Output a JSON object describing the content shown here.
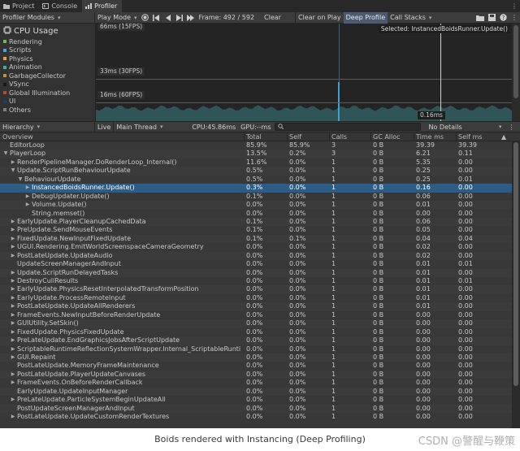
{
  "tabs": [
    {
      "label": "Project",
      "icon": "folder-icon"
    },
    {
      "label": "Console",
      "icon": "console-icon"
    },
    {
      "label": "Profiler",
      "icon": "profiler-icon"
    }
  ],
  "toolbar": {
    "modules_label": "Profiler Modules",
    "play_mode_label": "Play Mode",
    "frame_label": "Frame: 492 / 592",
    "clear_label": "Clear",
    "clear_on_play_label": "Clear on Play",
    "deep_profile_label": "Deep Profile",
    "call_stacks_label": "Call Stacks"
  },
  "module_panel": {
    "title": "CPU Usage",
    "items": [
      {
        "label": "Rendering",
        "color": "#6fbf44"
      },
      {
        "label": "Scripts",
        "color": "#3fa6e0"
      },
      {
        "label": "Physics",
        "color": "#e8a13a"
      },
      {
        "label": "Animation",
        "color": "#3bb2a5"
      },
      {
        "label": "GarbageCollector",
        "color": "#b59a2c"
      },
      {
        "label": "VSync",
        "color": "#1a1a1a"
      },
      {
        "label": "Global Illumination",
        "color": "#b8472e"
      },
      {
        "label": "UI",
        "color": "#1e3e66"
      },
      {
        "label": "Others",
        "color": "#7f7f7f"
      }
    ]
  },
  "graph": {
    "labels": [
      "66ms (15FPS)",
      "33ms (30FPS)",
      "16ms (60FPS)"
    ],
    "selected_label": "Selected: InstancedBoidsRunner.Update()",
    "selection_value": "0.16ms"
  },
  "hierarchy_bar": {
    "view_label": "Hierarchy",
    "live_label": "Live",
    "thread_label": "Main Thread",
    "cpu_label": "CPU:45.86ms",
    "gpu_label": "GPU:--ms",
    "search_placeholder": "",
    "details_label": "No Details"
  },
  "columns": [
    "Overview",
    "Total",
    "Self",
    "Calls",
    "GC Alloc",
    "Time ms",
    "Self ms"
  ],
  "rows": [
    {
      "name": "EditorLoop",
      "indent": 0,
      "arrow": "",
      "total": "85.9%",
      "self": "85.9%",
      "calls": "3",
      "gc": "0 B",
      "time": "39.39",
      "selfms": "39.39"
    },
    {
      "name": "PlayerLoop",
      "indent": 0,
      "arrow": "▼",
      "total": "13.5%",
      "self": "0.2%",
      "calls": "3",
      "gc": "0 B",
      "time": "6.21",
      "selfms": "0.11"
    },
    {
      "name": "RenderPipelineManager.DoRenderLoop_Internal()",
      "indent": 1,
      "arrow": "▶",
      "total": "11.6%",
      "self": "0.0%",
      "calls": "1",
      "gc": "0 B",
      "time": "5.35",
      "selfms": "0.00"
    },
    {
      "name": "Update.ScriptRunBehaviourUpdate",
      "indent": 1,
      "arrow": "▼",
      "total": "0.5%",
      "self": "0.0%",
      "calls": "1",
      "gc": "0 B",
      "time": "0.25",
      "selfms": "0.00"
    },
    {
      "name": "BehaviourUpdate",
      "indent": 2,
      "arrow": "▼",
      "total": "0.5%",
      "self": "0.0%",
      "calls": "1",
      "gc": "0 B",
      "time": "0.25",
      "selfms": "0.01"
    },
    {
      "name": "InstancedBoidsRunner.Update()",
      "indent": 3,
      "arrow": "▶",
      "total": "0.3%",
      "self": "0.0%",
      "calls": "1",
      "gc": "0 B",
      "time": "0.16",
      "selfms": "0.00",
      "selected": true
    },
    {
      "name": "DebugUpdater.Update()",
      "indent": 3,
      "arrow": "▶",
      "total": "0.1%",
      "self": "0.0%",
      "calls": "1",
      "gc": "0 B",
      "time": "0.06",
      "selfms": "0.00"
    },
    {
      "name": "Volume.Update()",
      "indent": 3,
      "arrow": "▶",
      "total": "0.0%",
      "self": "0.0%",
      "calls": "1",
      "gc": "0 B",
      "time": "0.01",
      "selfms": "0.00"
    },
    {
      "name": "String.memset()",
      "indent": 3,
      "arrow": "",
      "total": "0.0%",
      "self": "0.0%",
      "calls": "1",
      "gc": "0 B",
      "time": "0.00",
      "selfms": "0.00"
    },
    {
      "name": "EarlyUpdate.PlayerCleanupCachedData",
      "indent": 1,
      "arrow": "▶",
      "total": "0.1%",
      "self": "0.0%",
      "calls": "1",
      "gc": "0 B",
      "time": "0.06",
      "selfms": "0.00"
    },
    {
      "name": "PreUpdate.SendMouseEvents",
      "indent": 1,
      "arrow": "▶",
      "total": "0.1%",
      "self": "0.0%",
      "calls": "1",
      "gc": "0 B",
      "time": "0.05",
      "selfms": "0.00"
    },
    {
      "name": "FixedUpdate.NewInputFixedUpdate",
      "indent": 1,
      "arrow": "▶",
      "total": "0.1%",
      "self": "0.1%",
      "calls": "1",
      "gc": "0 B",
      "time": "0.04",
      "selfms": "0.04"
    },
    {
      "name": "UGUI.Rendering.EmitWorldScreenspaceCameraGeometry",
      "indent": 1,
      "arrow": "▶",
      "total": "0.0%",
      "self": "0.0%",
      "calls": "1",
      "gc": "0 B",
      "time": "0.02",
      "selfms": "0.00"
    },
    {
      "name": "PostLateUpdate.UpdateAudio",
      "indent": 1,
      "arrow": "▶",
      "total": "0.0%",
      "self": "0.0%",
      "calls": "1",
      "gc": "0 B",
      "time": "0.02",
      "selfms": "0.00"
    },
    {
      "name": "UpdateScreenManagerAndInput",
      "indent": 1,
      "arrow": "",
      "total": "0.0%",
      "self": "0.0%",
      "calls": "1",
      "gc": "0 B",
      "time": "0.01",
      "selfms": "0.01"
    },
    {
      "name": "Update.ScriptRunDelayedTasks",
      "indent": 1,
      "arrow": "▶",
      "total": "0.0%",
      "self": "0.0%",
      "calls": "1",
      "gc": "0 B",
      "time": "0.01",
      "selfms": "0.00"
    },
    {
      "name": "DestroyCullResults",
      "indent": 1,
      "arrow": "▶",
      "total": "0.0%",
      "self": "0.0%",
      "calls": "1",
      "gc": "0 B",
      "time": "0.01",
      "selfms": "0.01"
    },
    {
      "name": "EarlyUpdate.PhysicsResetInterpolatedTransformPosition",
      "indent": 1,
      "arrow": "▶",
      "total": "0.0%",
      "self": "0.0%",
      "calls": "1",
      "gc": "0 B",
      "time": "0.01",
      "selfms": "0.00"
    },
    {
      "name": "EarlyUpdate.ProcessRemoteInput",
      "indent": 1,
      "arrow": "▶",
      "total": "0.0%",
      "self": "0.0%",
      "calls": "1",
      "gc": "0 B",
      "time": "0.01",
      "selfms": "0.00"
    },
    {
      "name": "PostLateUpdate.UpdateAllRenderers",
      "indent": 1,
      "arrow": "▶",
      "total": "0.0%",
      "self": "0.0%",
      "calls": "1",
      "gc": "0 B",
      "time": "0.01",
      "selfms": "0.00"
    },
    {
      "name": "FrameEvents.NewInputBeforeRenderUpdate",
      "indent": 1,
      "arrow": "▶",
      "total": "0.0%",
      "self": "0.0%",
      "calls": "1",
      "gc": "0 B",
      "time": "0.00",
      "selfms": "0.00"
    },
    {
      "name": "GUIUtility.SetSkin()",
      "indent": 1,
      "arrow": "▶",
      "total": "0.0%",
      "self": "0.0%",
      "calls": "1",
      "gc": "0 B",
      "time": "0.00",
      "selfms": "0.00"
    },
    {
      "name": "FixedUpdate.PhysicsFixedUpdate",
      "indent": 1,
      "arrow": "▶",
      "total": "0.0%",
      "self": "0.0%",
      "calls": "1",
      "gc": "0 B",
      "time": "0.00",
      "selfms": "0.00"
    },
    {
      "name": "PreLateUpdate.EndGraphicsJobsAfterScriptUpdate",
      "indent": 1,
      "arrow": "▶",
      "total": "0.0%",
      "self": "0.0%",
      "calls": "1",
      "gc": "0 B",
      "time": "0.00",
      "selfms": "0.00"
    },
    {
      "name": "ScriptableRuntimeReflectionSystemWrapper.Internal_ScriptableRuntimeRefle",
      "indent": 1,
      "arrow": "▶",
      "total": "0.0%",
      "self": "0.0%",
      "calls": "1",
      "gc": "0 B",
      "time": "0.00",
      "selfms": "0.00"
    },
    {
      "name": "GUI.Repaint",
      "indent": 1,
      "arrow": "▶",
      "total": "0.0%",
      "self": "0.0%",
      "calls": "1",
      "gc": "0 B",
      "time": "0.00",
      "selfms": "0.00"
    },
    {
      "name": "PostLateUpdate.MemoryFrameMaintenance",
      "indent": 1,
      "arrow": "",
      "total": "0.0%",
      "self": "0.0%",
      "calls": "1",
      "gc": "0 B",
      "time": "0.00",
      "selfms": "0.00"
    },
    {
      "name": "PostLateUpdate.PlayerUpdateCanvases",
      "indent": 1,
      "arrow": "▶",
      "total": "0.0%",
      "self": "0.0%",
      "calls": "1",
      "gc": "0 B",
      "time": "0.00",
      "selfms": "0.00"
    },
    {
      "name": "FrameEvents.OnBeforeRenderCallback",
      "indent": 1,
      "arrow": "▶",
      "total": "0.0%",
      "self": "0.0%",
      "calls": "1",
      "gc": "0 B",
      "time": "0.00",
      "selfms": "0.00"
    },
    {
      "name": "EarlyUpdate.UpdateInputManager",
      "indent": 1,
      "arrow": "",
      "total": "0.0%",
      "self": "0.0%",
      "calls": "1",
      "gc": "0 B",
      "time": "0.00",
      "selfms": "0.00"
    },
    {
      "name": "PreLateUpdate.ParticleSystemBeginUpdateAll",
      "indent": 1,
      "arrow": "▶",
      "total": "0.0%",
      "self": "0.0%",
      "calls": "1",
      "gc": "0 B",
      "time": "0.00",
      "selfms": "0.00"
    },
    {
      "name": "PostUpdateScreenManagerAndInput",
      "indent": 1,
      "arrow": "",
      "total": "0.0%",
      "self": "0.0%",
      "calls": "1",
      "gc": "0 B",
      "time": "0.00",
      "selfms": "0.00"
    },
    {
      "name": "PostLateUpdate.UpdateCustomRenderTextures",
      "indent": 1,
      "arrow": "▶",
      "total": "0.0%",
      "self": "0.0%",
      "calls": "1",
      "gc": "0 B",
      "time": "0.00",
      "selfms": "0.00"
    }
  ],
  "caption": "Boids rendered with Instancing (Deep Profiling)",
  "watermark": "CSDN @警醒与鞭策",
  "colors": {
    "selection": "#2c5d87",
    "panel": "#383838",
    "graph_bg": "#242424",
    "graph_area": "#3a7d82"
  }
}
